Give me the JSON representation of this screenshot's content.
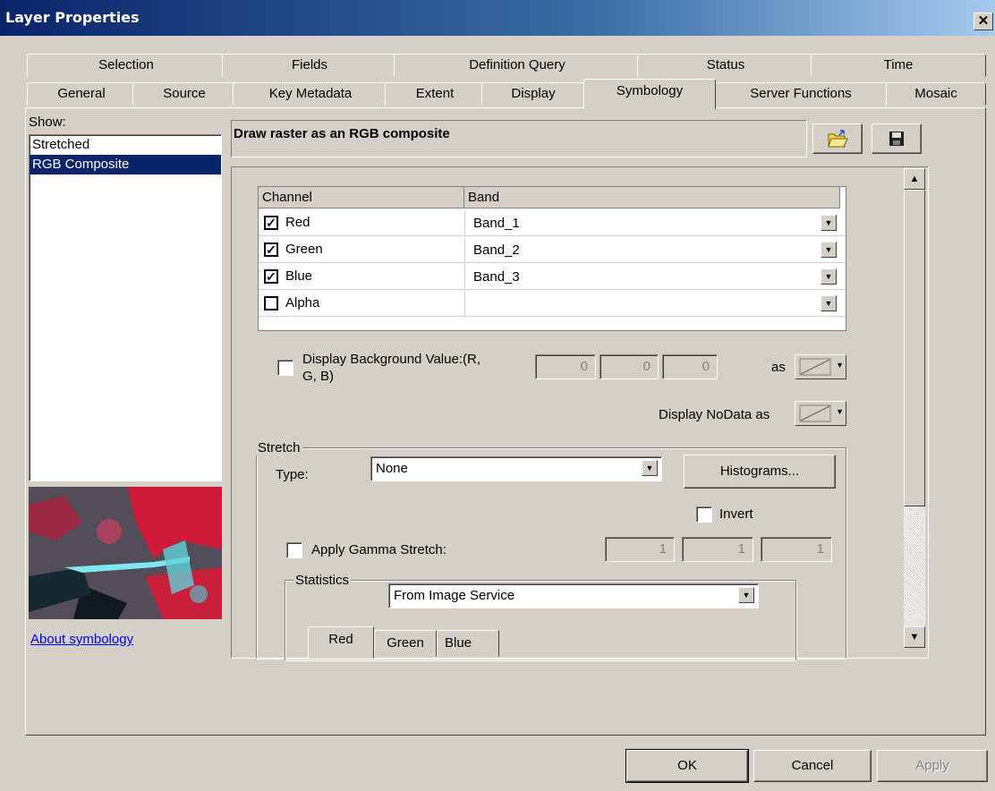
{
  "window": {
    "title": "Layer Properties",
    "close_glyph": "✕"
  },
  "tabs_row1": [
    "Selection",
    "Fields",
    "Definition Query",
    "Status",
    "Time"
  ],
  "tabs_row2": [
    "General",
    "Source",
    "Key Metadata",
    "Extent",
    "Display",
    "Symbology",
    "Server Functions",
    "Mosaic"
  ],
  "active_tab": "Symbology",
  "show": {
    "label": "Show:",
    "items": [
      "Stretched",
      "RGB Composite"
    ],
    "selected": "RGB Composite"
  },
  "about_link": "About symbology",
  "renderer_header": "Draw raster as an RGB composite",
  "grid": {
    "headers": [
      "Channel",
      "Band"
    ],
    "rows": [
      {
        "channel": "Red",
        "band": "Band_1",
        "checked": true
      },
      {
        "channel": "Green",
        "band": "Band_2",
        "checked": true
      },
      {
        "channel": "Blue",
        "band": "Band_3",
        "checked": true
      },
      {
        "channel": "Alpha",
        "band": "",
        "checked": false
      }
    ]
  },
  "background": {
    "label_line1": "Display Background Value:(R,",
    "label_line2": "G, B)",
    "values": [
      "0",
      "0",
      "0"
    ],
    "as_label": "as"
  },
  "nodata_label": "Display NoData as",
  "stretch": {
    "group_label": "Stretch",
    "type_label": "Type:",
    "type_value": "None",
    "histograms_button": "Histograms...",
    "invert_label": "Invert",
    "gamma_label": "Apply Gamma Stretch:",
    "gamma_values": [
      "1",
      "1",
      "1"
    ]
  },
  "statistics": {
    "group_label": "Statistics",
    "source": "From Image Service",
    "tabs": [
      "Red",
      "Green",
      "Blue"
    ]
  },
  "buttons": {
    "ok": "OK",
    "cancel": "Cancel",
    "apply": "Apply"
  },
  "icons": {
    "open": "folder-open-icon",
    "save": "floppy-disk-icon",
    "dropdown_glyph": "▼",
    "check_glyph": "✓",
    "scroll_up_glyph": "▲",
    "scroll_down_glyph": "▼"
  },
  "colors": {
    "titlebar_start": "#0a246a",
    "selection": "#0a246a",
    "link": "#0000ee",
    "face": "#d4d0c8"
  }
}
